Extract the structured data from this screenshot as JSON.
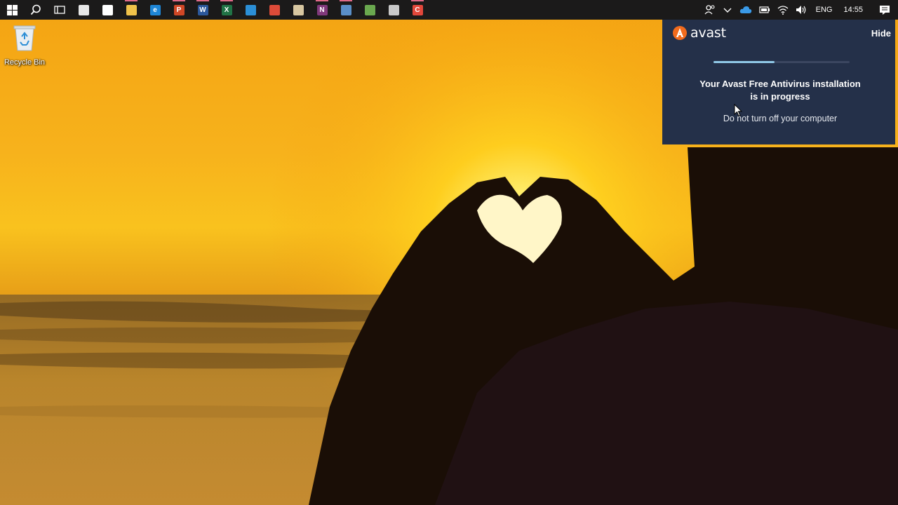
{
  "taskbar": {
    "apps": [
      {
        "name": "store",
        "letter": "",
        "color": "#e8e8e8"
      },
      {
        "name": "mail",
        "letter": "",
        "color": "#ffffff"
      },
      {
        "name": "file-explorer",
        "letter": "",
        "color": "#f0c24a"
      },
      {
        "name": "edge",
        "letter": "e",
        "color": "#1e86d6"
      },
      {
        "name": "powerpoint",
        "letter": "P",
        "color": "#d04726"
      },
      {
        "name": "word",
        "letter": "W",
        "color": "#2b579a"
      },
      {
        "name": "excel",
        "letter": "X",
        "color": "#217346"
      },
      {
        "name": "vscode",
        "letter": "",
        "color": "#2b8fd6"
      },
      {
        "name": "chrome",
        "letter": "",
        "color": "#dd4b39"
      },
      {
        "name": "tools",
        "letter": "",
        "color": "#d8c7a1"
      },
      {
        "name": "onenote",
        "letter": "N",
        "color": "#80397b"
      },
      {
        "name": "paint",
        "letter": "",
        "color": "#5a8fc8"
      },
      {
        "name": "camtasia",
        "letter": "",
        "color": "#6aa84f"
      },
      {
        "name": "gallery",
        "letter": "",
        "color": "#c9c9c9"
      },
      {
        "name": "recorder",
        "letter": "C",
        "color": "#e2473b"
      }
    ],
    "tray": {
      "language": "ENG",
      "time": "14:55"
    }
  },
  "desktop": {
    "recycle_bin_label": "Recycle Bin"
  },
  "avast": {
    "brand": "avast",
    "hide_label": "Hide",
    "progress": 0.45,
    "title_line1": "Your Avast Free Antivirus installation",
    "title_line2": "is in progress",
    "subtitle": "Do not turn off your computer",
    "accent_color": "#f26b1d"
  }
}
